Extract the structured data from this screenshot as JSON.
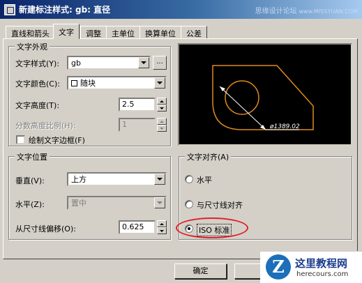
{
  "window": {
    "title": "新建标注样式: gb: 直径",
    "watermark": "思缘设计论坛",
    "watermark_url": "www.MISSYUAN.COM"
  },
  "tabs": [
    {
      "label": "直线和箭头"
    },
    {
      "label": "文字"
    },
    {
      "label": "调整"
    },
    {
      "label": "主单位"
    },
    {
      "label": "换算单位"
    },
    {
      "label": "公差"
    }
  ],
  "appearance": {
    "title": "文字外观",
    "style_label": "文字样式",
    "style_key": "(Y)",
    "style_value": "gb",
    "ellipsis": "...",
    "color_label": "文字颜色",
    "color_key": "(C)",
    "color_value": "随块",
    "height_label": "文字高度",
    "height_key": "(T)",
    "height_value": "2.5",
    "fraction_label": "分数高度比例",
    "fraction_key": "(H)",
    "fraction_value": "1",
    "frame_label": "绘制文字边框",
    "frame_key": "(F)"
  },
  "placement": {
    "title": "文字位置",
    "vertical_label": "垂直",
    "vertical_key": "(V)",
    "vertical_value": "上方",
    "horizontal_label": "水平",
    "horizontal_key": "(Z)",
    "horizontal_value": "置中",
    "offset_label": "从尺寸线偏移",
    "offset_key": "(O)",
    "offset_value": "0.625"
  },
  "preview": {
    "dimension_text": "ø1389.02",
    "line_color": "#e08a1e"
  },
  "alignment": {
    "title": "文字对齐",
    "title_key": "(A)",
    "options": [
      {
        "label": "水平",
        "checked": false
      },
      {
        "label": "与尺寸线对齐",
        "checked": false
      },
      {
        "label": "ISO 标准",
        "checked": true
      }
    ]
  },
  "buttons": {
    "ok": "确定"
  },
  "logo": {
    "letter": "Z",
    "name": "这里教程网",
    "url": "herecours.com"
  },
  "colors": {
    "highlight": "#e0202a"
  }
}
